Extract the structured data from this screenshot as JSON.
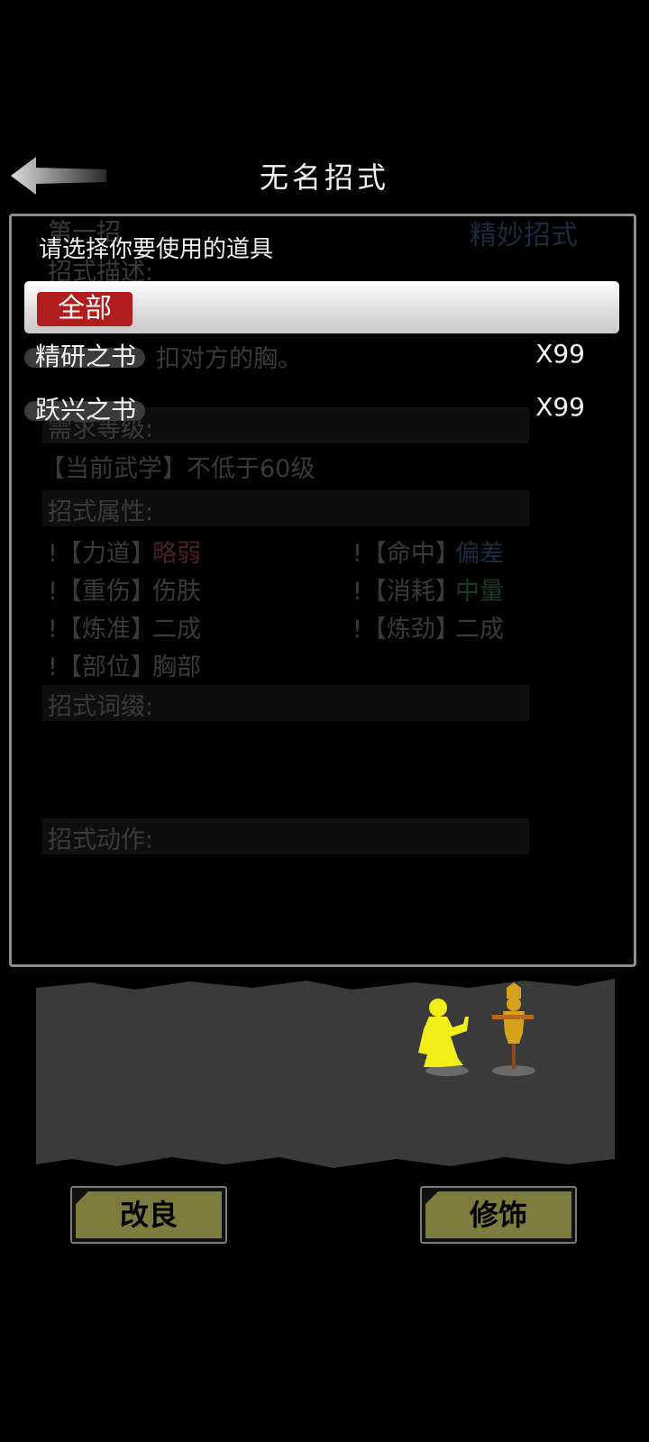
{
  "header": {
    "title": "无名招式",
    "back_icon": "back-arrow-icon"
  },
  "background_panel": {
    "heading_left": "第一招",
    "heading_right": "精妙招式",
    "desc_label": "招式描述:",
    "desc_text": "扣对方的胸。",
    "level_label": "需求等级:",
    "level_text": "【当前武学】不低于60级",
    "attr_label": "招式属性:",
    "attrs": [
      {
        "key": "!【力道】",
        "val": "略弱"
      },
      {
        "key": "!【命中】",
        "val": "偏差"
      },
      {
        "key": "!【重伤】",
        "val": "伤肤"
      },
      {
        "key": "!【消耗】",
        "val": "中量"
      },
      {
        "key": "!【炼准】",
        "val": "二成"
      },
      {
        "key": "!【炼劲】",
        "val": "二成"
      },
      {
        "key": "!【部位】",
        "val": "胸部"
      }
    ],
    "suffix_label": "招式词缀:",
    "action_label": "招式动作:"
  },
  "popup": {
    "title": "请选择你要使用的道具",
    "filter_selected": "全部",
    "items": [
      {
        "name": "精研之书",
        "count": "X99"
      },
      {
        "name": "跃兴之书",
        "count": "X99"
      }
    ]
  },
  "buttons": {
    "improve": "改良",
    "decorate": "修饰"
  },
  "colors": {
    "filter_chip": "#b11c1c",
    "button_fill": "#7d7b3d",
    "fighter": "#f2ee1a",
    "dummy": "#d6a21e"
  }
}
